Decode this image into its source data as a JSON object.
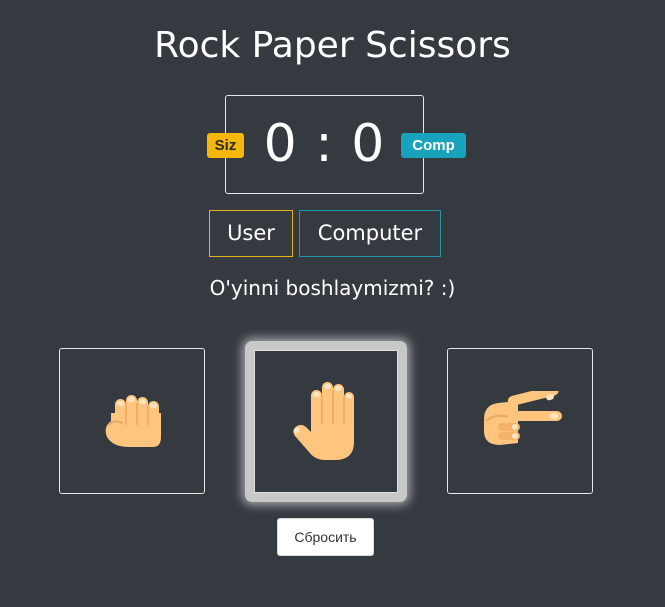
{
  "header": {
    "title": "Rock Paper Scissors"
  },
  "scoreboard": {
    "user_badge": "Siz",
    "comp_badge": "Comp",
    "score_text": "0 : 0",
    "user_score": 0,
    "comp_score": 0
  },
  "legend": {
    "user": "User",
    "computer": "Computer"
  },
  "message": "O'yinni boshlaymizmi? :)",
  "choices": [
    {
      "name": "rock",
      "icon": "fist-icon"
    },
    {
      "name": "paper",
      "icon": "open-hand-icon",
      "selected": true
    },
    {
      "name": "scissors",
      "icon": "scissors-hand-icon"
    }
  ],
  "reset_label": "Сбросить",
  "colors": {
    "background": "#353a41",
    "user_accent": "#f5b70c",
    "comp_accent": "#18a2bb",
    "skin": "#fdc57e"
  }
}
